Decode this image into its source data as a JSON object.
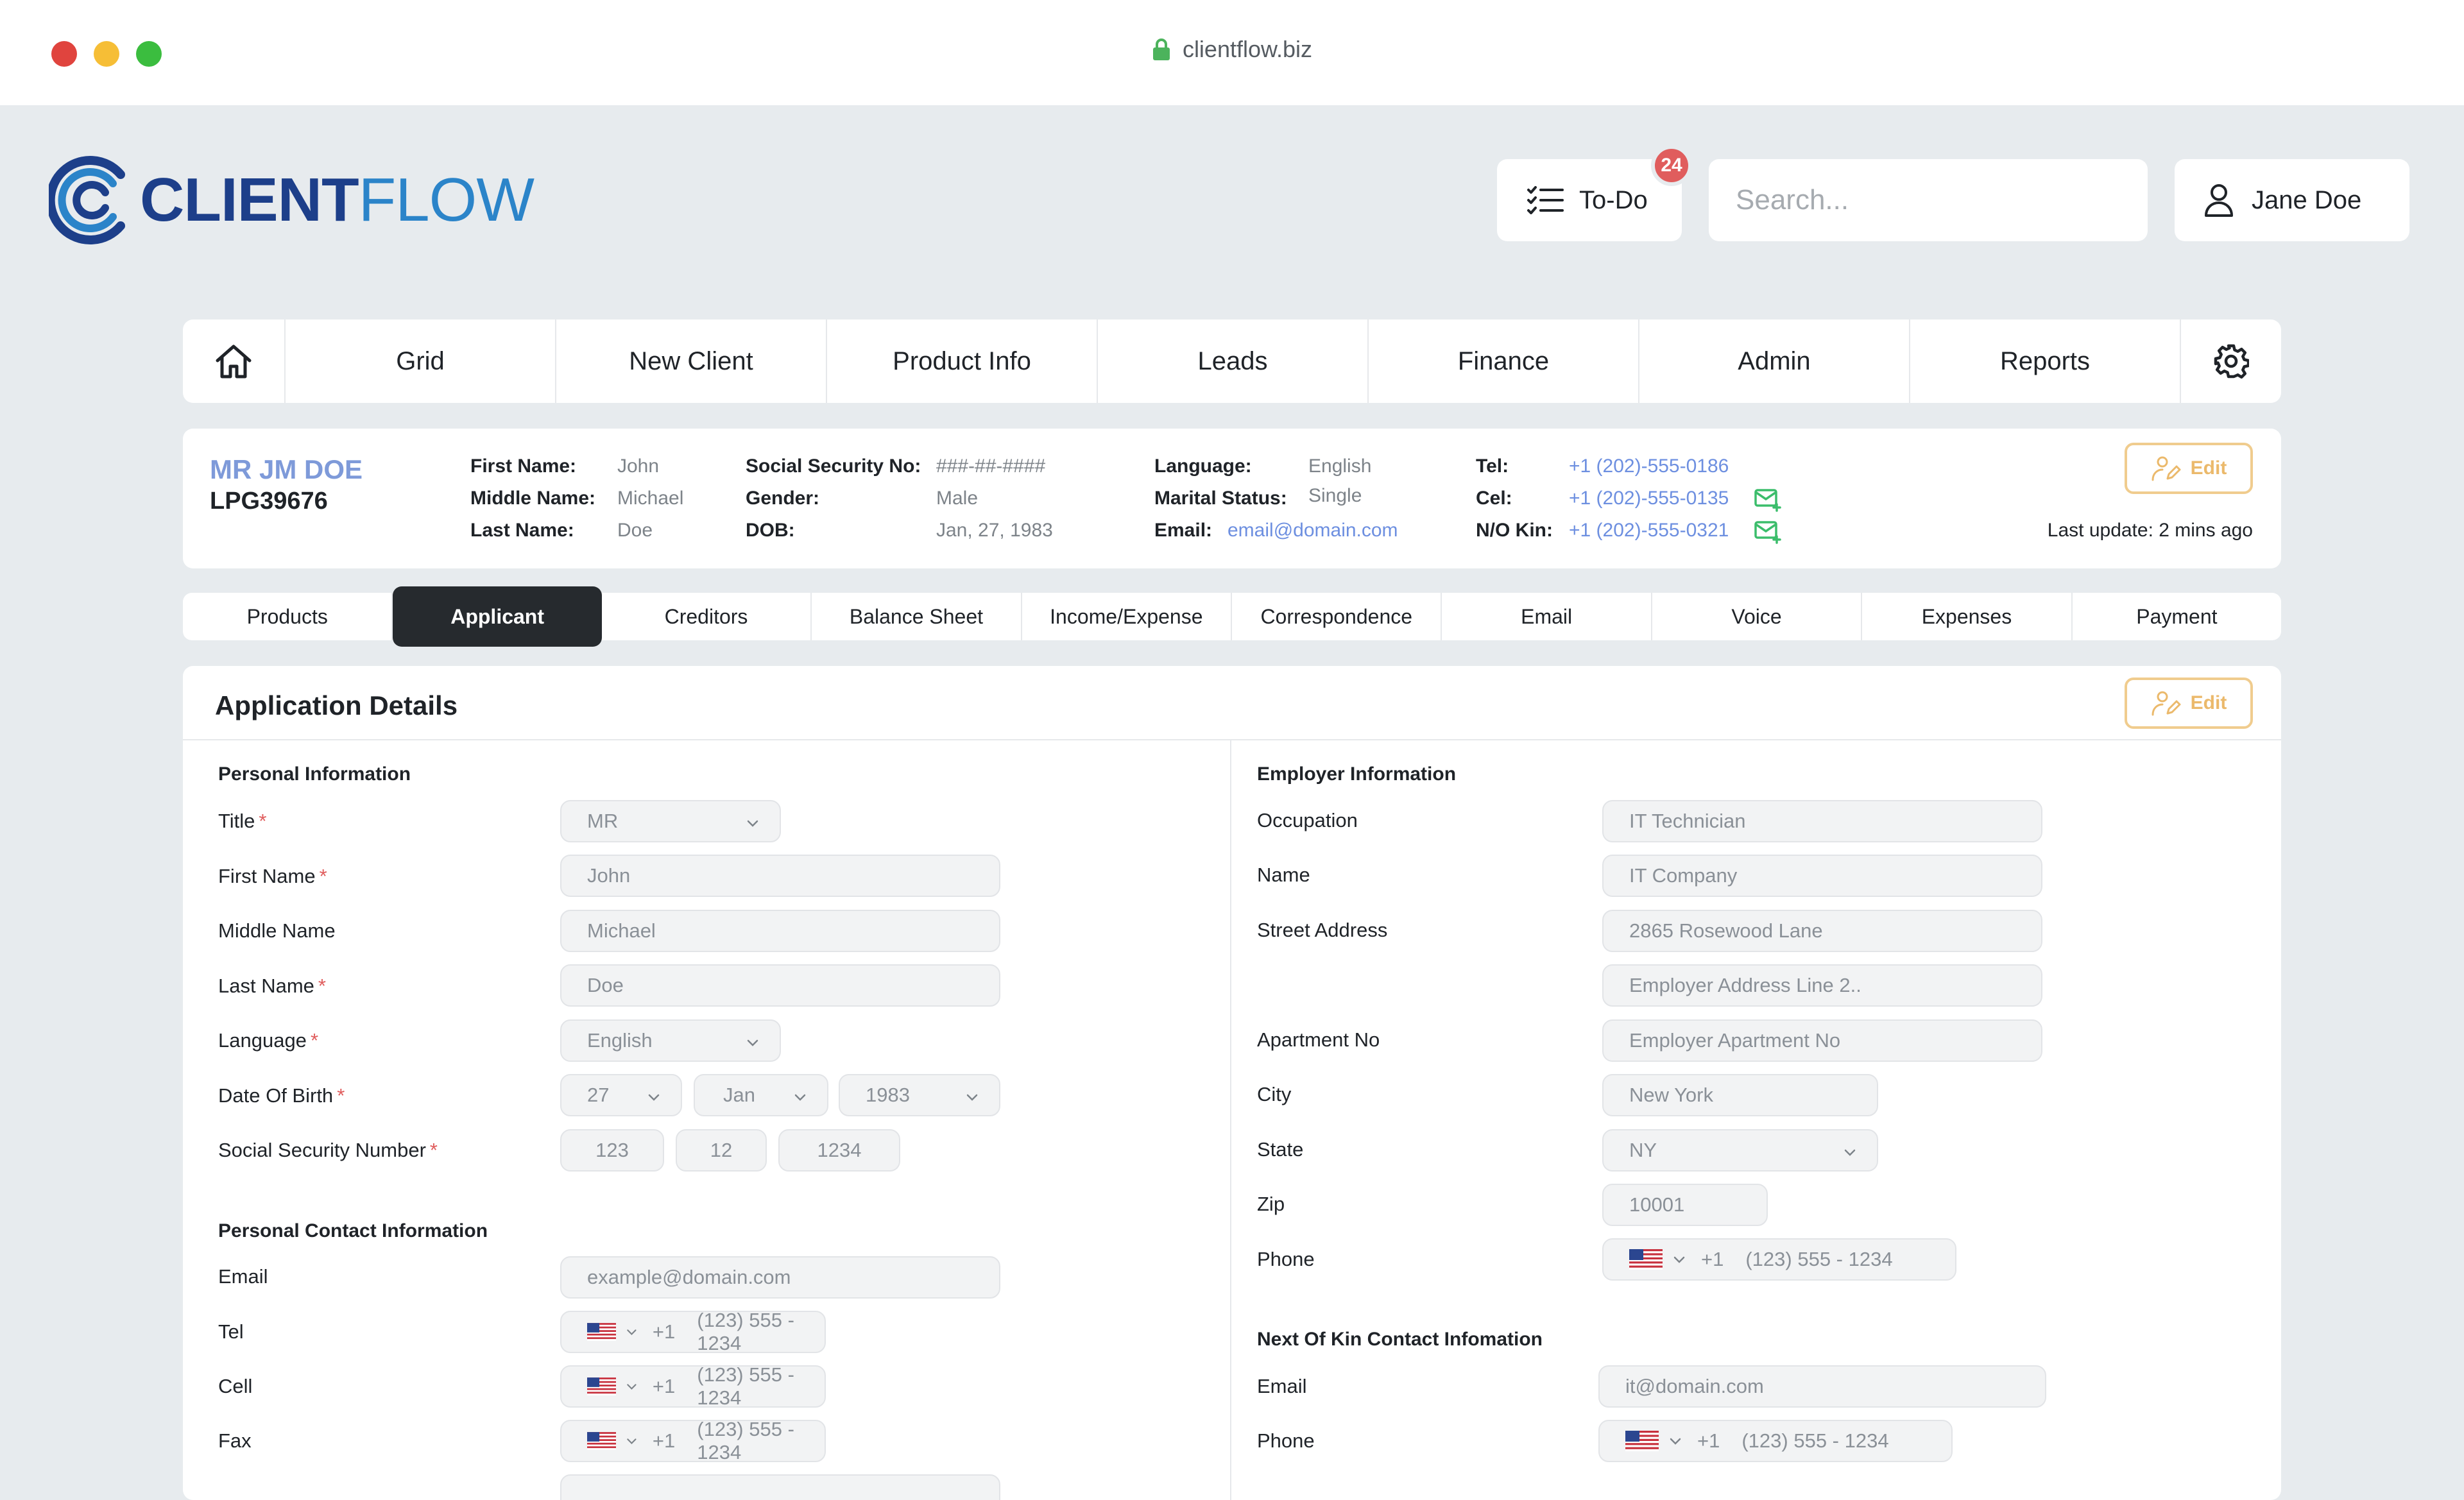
{
  "browser": {
    "url": "clientflow.biz"
  },
  "header": {
    "logo_bold": "CLIENT",
    "logo_light": "FLOW",
    "todo_label": "To-Do",
    "todo_count": "24",
    "search_placeholder": "Search...",
    "user_name": "Jane Doe"
  },
  "nav": {
    "items": [
      "Grid",
      "New Client",
      "Product Info",
      "Leads",
      "Finance",
      "Admin",
      "Reports"
    ]
  },
  "summary": {
    "name": "MR JM DOE",
    "id": "LPG39676",
    "first_name_label": "First Name:",
    "first_name": "John",
    "middle_name_label": "Middle Name:",
    "middle_name": "Michael",
    "last_name_label": "Last Name:",
    "last_name": "Doe",
    "ssn_label": "Social Security No:",
    "ssn": "###-##-####",
    "gender_label": "Gender:",
    "gender": "Male",
    "dob_label": "DOB:",
    "dob": "Jan, 27, 1983",
    "language_label": "Language:",
    "language": "English",
    "marital_label": "Marital Status:",
    "marital": "Single",
    "email_label": "Email:",
    "email": "email@domain.com",
    "tel_label": "Tel:",
    "tel": "+1 (202)-555-0186",
    "cel_label": "Cel:",
    "cel": "+1 (202)-555-0135",
    "nok_label": "N/O Kin:",
    "nok": "+1 (202)-555-0321",
    "edit_label": "Edit",
    "last_update": "Last update: 2 mins ago"
  },
  "tabs": [
    "Products",
    "Applicant",
    "Creditors",
    "Balance Sheet",
    "Income/Expense",
    "Correspondence",
    "Email",
    "Voice",
    "Expenses",
    "Payment"
  ],
  "active_tab": "Applicant",
  "details": {
    "title": "Application Details",
    "edit_label": "Edit",
    "personal": {
      "heading": "Personal Information",
      "title_label": "Title",
      "title_value": "MR",
      "first_label": "First Name",
      "first_value": "John",
      "middle_label": "Middle Name",
      "middle_value": "Michael",
      "last_label": "Last Name",
      "last_value": "Doe",
      "language_label": "Language",
      "language_value": "English",
      "dob_label": "Date Of Birth",
      "dob_day": "27",
      "dob_month": "Jan",
      "dob_year": "1983",
      "ssn_label": "Social Security Number",
      "ssn_1": "123",
      "ssn_2": "12",
      "ssn_3": "1234"
    },
    "contact": {
      "heading": "Personal Contact Information",
      "email_label": "Email",
      "email_placeholder": "example@domain.com",
      "tel_label": "Tel",
      "cell_label": "Cell",
      "fax_label": "Fax",
      "country_code": "+1",
      "phone_placeholder": "(123) 555 - 1234"
    },
    "employer": {
      "heading": "Employer Information",
      "occupation_label": "Occupation",
      "occupation_value": "IT Technician",
      "name_label": "Name",
      "name_value": "IT Company",
      "street_label": "Street Address",
      "street_value": "2865 Rosewood Lane",
      "address2_placeholder": "Employer Address Line 2..",
      "apt_label": "Apartment No",
      "apt_placeholder": "Employer Apartment No",
      "city_label": "City",
      "city_value": "New York",
      "state_label": "State",
      "state_value": "NY",
      "zip_label": "Zip",
      "zip_value": "10001",
      "phone_label": "Phone",
      "country_code": "+1",
      "phone_placeholder": "(123) 555 - 1234"
    },
    "nok": {
      "heading": "Next Of Kin Contact Infomation",
      "email_label": "Email",
      "email_placeholder": "it@domain.com",
      "phone_label": "Phone",
      "country_code": "+1",
      "phone_placeholder": "(123) 555 - 1234"
    }
  },
  "colors": {
    "accent_blue": "#6d8fe0",
    "edit_orange": "#ebb96b",
    "required_red": "#e05d5d",
    "active_tab": "#262a2e"
  }
}
